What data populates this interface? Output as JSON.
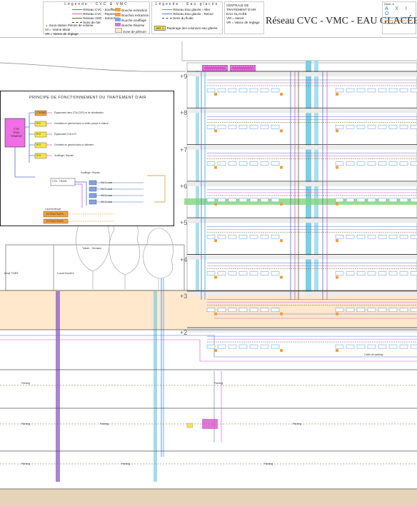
{
  "header": {
    "legend_cvc_title": "Légende : CVC & VMC",
    "legend_cvc_items": [
      "Réseau CVC - Soufflage",
      "Réseau CVC - Reprise",
      "Réseau VMC - Extraction",
      "Sens de l'air"
    ],
    "legend_cvc_extra": [
      "Bouche extraction",
      "Bouches extraction"
    ],
    "legend_cvc_bottom": [
      "Bouche soufflage",
      "Bouche Reprise",
      "Zone de plénum"
    ],
    "legend_cvc_misc": [
      "Sous-station",
      "Pièces de volume",
      "VA = Vanne Mixte",
      "VR = Vanne de réglage"
    ],
    "legend_water_title": "Légende : Eau glacée",
    "legend_water_items": [
      "Réseau Eau glacée - Aller",
      "Réseau Eau glacée - Retour",
      "Sens du fluide"
    ],
    "legend_water_tag": "BO 1",
    "legend_water_tag_label": "Repérage des colonnes eau glacée",
    "legend_water_box": [
      "CENTRALE DE TRAITEMENT D'AIR",
      "EAU GLACÉE",
      "VM = Vanne",
      "VR = Vanne de réglage"
    ],
    "main_title": "Réseau CVC - VMC - EAU GLACÉE",
    "logo_lines": [
      "Client : A",
      "A X I O",
      "Ecodigeance et Ingénierie",
      "Gestion Technique de Patrimoine"
    ]
  },
  "principe": {
    "title": "PRINCIPE DE FONCTIONNEMENT DU TRAITEMENT D'AIR",
    "central_unit": [
      "CTA",
      "TRAI-",
      "TEMENT"
    ],
    "top_rows": [
      {
        "tag": "CTA BAS",
        "label": "Équipement dans CTA (CG/S) et de climatisation"
      },
      {
        "tag": "R+1",
        "label": "Centrales en général dans un chiller pompe à chaleur"
      },
      {
        "tag": "R+2",
        "label": "Équipement CVA et R"
      },
      {
        "tag": "R+3",
        "label": "Centrales en général dans un bâtiment"
      },
      {
        "tag": "R+4",
        "label": "Soufflage / Reprise"
      }
    ],
    "middle_box": "CTA - TRAIN",
    "middle_label": "Soufflage / Reprise",
    "branch_labels": [
      "VM 1 Local",
      "VM 2 Local",
      "VM 3 Local",
      "VM 4 Local"
    ],
    "bottom_boxes": [
      "EXTRACTEURS",
      "EXTRACTEURS"
    ],
    "bottom_labels": [
      "Local technique",
      "Local technique"
    ]
  },
  "floors": [
    "+9",
    "+8",
    "+7",
    "+6",
    "+5",
    "+4",
    "+3",
    "+2"
  ],
  "rooms": {
    "left_low": [
      "local TGBT",
      "Local enceint"
    ],
    "terrasse": "Toiture - Terrasse",
    "parking": "Parking",
    "car": "Cafet de parking"
  },
  "colors": {
    "supply": "#4e6fd6",
    "return": "#d455c8",
    "extract": "#7a5a2a",
    "chw_supply": "#3aa2e0",
    "chw_return": "#8b5cc6",
    "plenum": "#ffe8cc",
    "shaft": "#79cfe4"
  }
}
